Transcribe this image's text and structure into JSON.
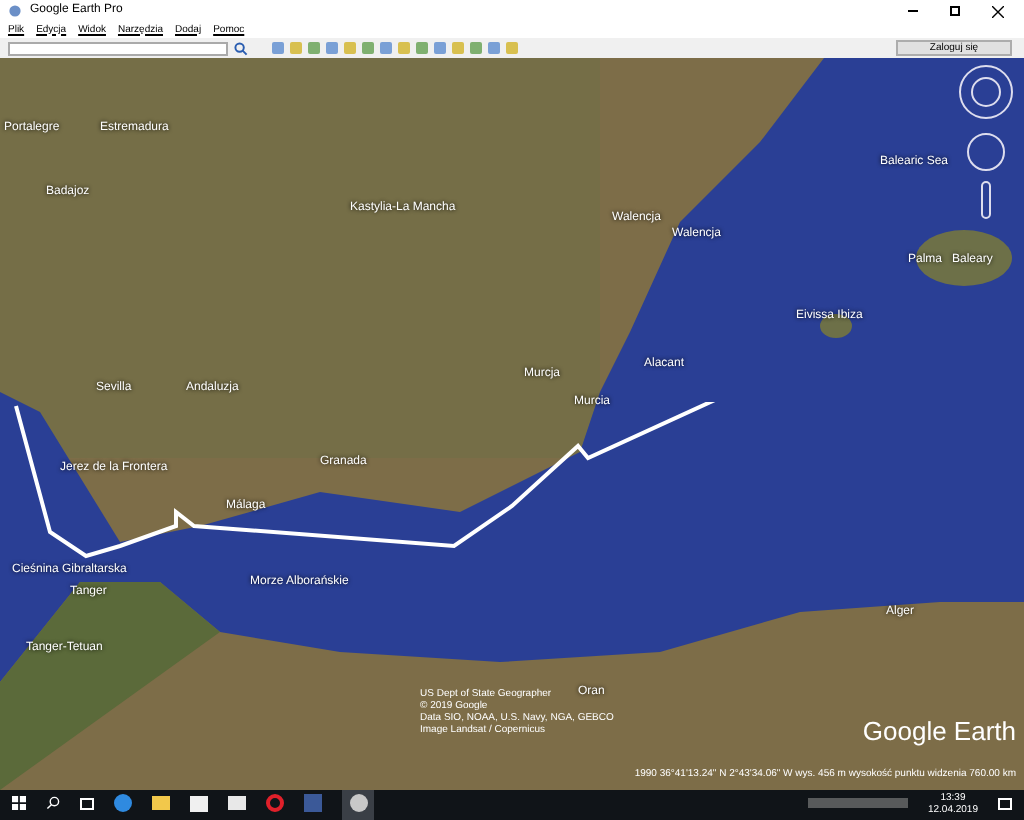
{
  "window": {
    "title": "Google Earth Pro"
  },
  "menu": [
    "Plik",
    "Edycja",
    "Widok",
    "Narzędzia",
    "Dodaj",
    "Pomoc"
  ],
  "toolbar": {
    "sign_in": "Zaloguj się"
  },
  "map": {
    "labels": [
      {
        "text": "Portalegre"
      },
      {
        "text": "Estremadura"
      },
      {
        "text": "Badajoz"
      },
      {
        "text": "Kastylia-La Mancha"
      },
      {
        "text": "Walencja"
      },
      {
        "text": "Walencja"
      },
      {
        "text": "Balearic Sea"
      },
      {
        "text": "Palma"
      },
      {
        "text": "Baleary"
      },
      {
        "text": "Eivissa Ibiza"
      },
      {
        "text": "Sevilla"
      },
      {
        "text": "Andaluzja"
      },
      {
        "text": "Jerez de la Frontera"
      },
      {
        "text": "Málaga"
      },
      {
        "text": "Granada"
      },
      {
        "text": "Murcja"
      },
      {
        "text": "Murcia"
      },
      {
        "text": "Alacant"
      },
      {
        "text": "Cieśnina Gibraltarska"
      },
      {
        "text": "Tanger"
      },
      {
        "text": "Tanger-Tetuan"
      },
      {
        "text": "Morze Alborańskie"
      },
      {
        "text": "Alger"
      },
      {
        "text": "Oran"
      }
    ],
    "attribution": [
      "US Dept of State Geographer",
      "© 2019 Google",
      "Data SIO, NOAA, U.S. Navy, NGA, GEBCO",
      "Image Landsat / Copernicus"
    ],
    "logo": "Google Earth",
    "status": "1990   36°41'13.24\" N   2°43'34.06\" W   wys. 456 m   wysokość punktu widzenia 760.00 km"
  },
  "taskbar": {
    "time": "13:39",
    "date": "12.04.2019"
  }
}
